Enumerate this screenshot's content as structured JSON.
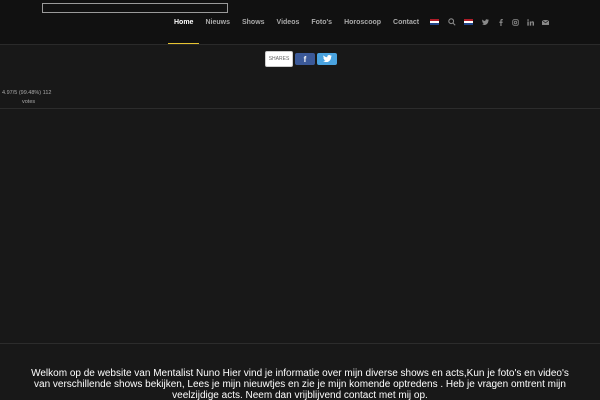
{
  "nav": {
    "items": [
      {
        "label": "Home",
        "active": true
      },
      {
        "label": "Nieuws",
        "active": false
      },
      {
        "label": "Shows",
        "active": false
      },
      {
        "label": "Videos",
        "active": false
      },
      {
        "label": "Foto's",
        "active": false
      },
      {
        "label": "Horoscoop",
        "active": false
      },
      {
        "label": "Contact",
        "active": false
      }
    ],
    "active_underline_color": "#e7c431"
  },
  "header_icons": [
    "search-icon",
    "flag-nl-icon",
    "twitter-icon",
    "facebook-icon",
    "instagram-icon",
    "linkedin-icon",
    "mail-icon"
  ],
  "share": {
    "shares_label": "SHARES",
    "facebook_glyph": "f",
    "twitter_glyph": "t",
    "facebook_color": "#3b5998",
    "twitter_color": "#4aa3df"
  },
  "rating": {
    "text": "4.97/5 (99.48%) 112",
    "votes": "votes"
  },
  "welcome": {
    "text": "Welkom op de website van Mentalist Nuno Hier vind je informatie over mijn diverse shows en acts,Kun je foto's en video's van verschillende shows bekijken, Lees je mijn nieuwtjes en zie je mijn komende optredens . Heb je vragen omtrent mijn veelzijdige acts. Neem dan vrijblijvend contact met mij op."
  }
}
